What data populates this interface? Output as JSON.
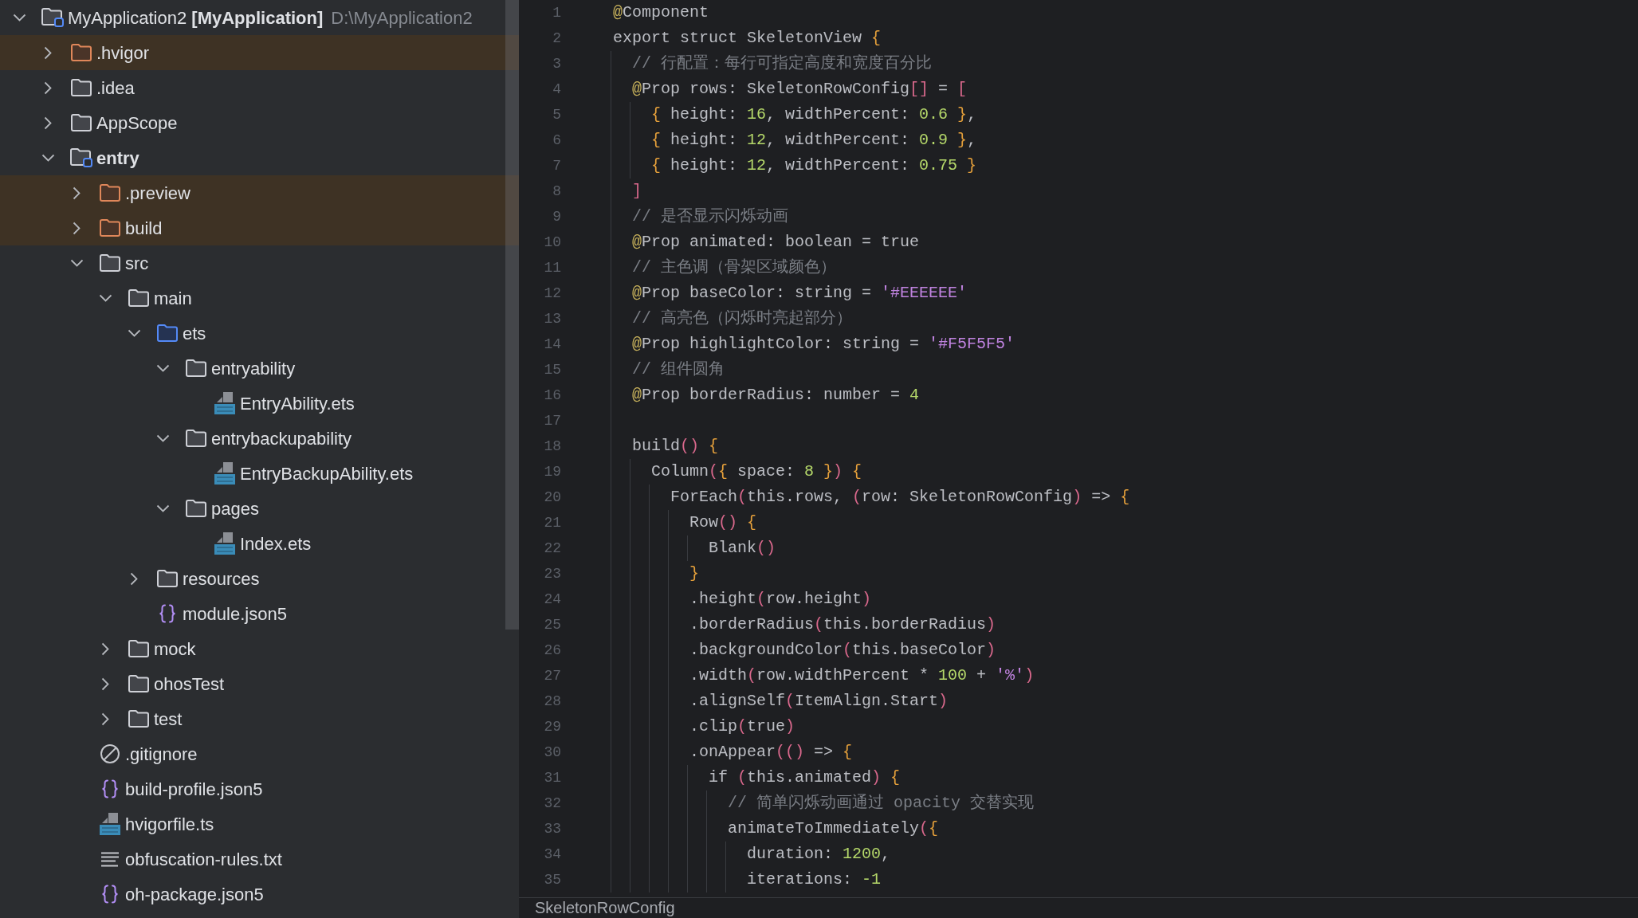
{
  "project_tree": {
    "items": [
      {
        "kind": "project",
        "name": "MyApplication2 **[MyApplication]**",
        "path": "D:\\MyApplication2",
        "expanded": true,
        "excluded": false,
        "children": [
          {
            "kind": "folder",
            "name": ".hvigor",
            "expanded": false,
            "excluded": true
          },
          {
            "kind": "folder",
            "name": ".idea",
            "expanded": false,
            "excluded": false
          },
          {
            "kind": "folder",
            "name": "AppScope",
            "expanded": false,
            "excluded": false
          },
          {
            "kind": "module",
            "name": "entry",
            "expanded": true,
            "excluded": false,
            "children": [
              {
                "kind": "folder",
                "name": ".preview",
                "expanded": false,
                "excluded": true
              },
              {
                "kind": "folder",
                "name": "build",
                "expanded": false,
                "excluded": true
              },
              {
                "kind": "folder",
                "name": "src",
                "expanded": true,
                "excluded": false,
                "children": [
                  {
                    "kind": "folder",
                    "name": "main",
                    "expanded": true,
                    "excluded": false,
                    "children": [
                      {
                        "kind": "source_folder",
                        "name": "ets",
                        "expanded": true,
                        "excluded": false,
                        "children": [
                          {
                            "kind": "folder",
                            "name": "entryability",
                            "expanded": true,
                            "excluded": false,
                            "children": [
                              {
                                "kind": "ets",
                                "name": "EntryAbility.ets",
                                "excluded": false
                              }
                            ]
                          },
                          {
                            "kind": "folder",
                            "name": "entrybackupability",
                            "expanded": true,
                            "excluded": false,
                            "children": [
                              {
                                "kind": "ets",
                                "name": "EntryBackupAbility.ets",
                                "excluded": false
                              }
                            ]
                          },
                          {
                            "kind": "folder",
                            "name": "pages",
                            "expanded": true,
                            "excluded": false,
                            "children": [
                              {
                                "kind": "ets",
                                "name": "Index.ets",
                                "excluded": false
                              }
                            ]
                          }
                        ]
                      },
                      {
                        "kind": "folder",
                        "name": "resources",
                        "expanded": false,
                        "excluded": false
                      },
                      {
                        "kind": "json5",
                        "name": "module.json5",
                        "excluded": false
                      }
                    ]
                  },
                  {
                    "kind": "folder",
                    "name": "mock",
                    "expanded": false,
                    "excluded": false
                  },
                  {
                    "kind": "folder",
                    "name": "ohosTest",
                    "expanded": false,
                    "excluded": false
                  },
                  {
                    "kind": "folder",
                    "name": "test",
                    "expanded": false,
                    "excluded": false
                  }
                ]
              },
              {
                "kind": "gitignore",
                "name": ".gitignore",
                "excluded": false
              },
              {
                "kind": "json5",
                "name": "build-profile.json5",
                "excluded": false
              },
              {
                "kind": "ts",
                "name": "hvigorfile.ts",
                "excluded": false
              },
              {
                "kind": "text",
                "name": "obfuscation-rules.txt",
                "excluded": false
              },
              {
                "kind": "json5",
                "name": "oh-package.json5",
                "excluded": false
              }
            ]
          }
        ]
      }
    ]
  },
  "editor": {
    "lines": [
      {
        "number": "1",
        "tokens": [
          {
            "kind": "annotation",
            "text": "@"
          },
          {
            "kind": "plain",
            "text": "Component"
          }
        ]
      },
      {
        "number": "2",
        "tokens": [
          {
            "kind": "plain",
            "text": "export struct SkeletonView "
          },
          {
            "kind": "brace",
            "text": "{"
          }
        ],
        "children": [
          {
            "number": "3",
            "tokens": [
              {
                "kind": "comment",
                "text": "// 行配置：每行可指定高度和宽度百分比"
              }
            ]
          },
          {
            "number": "4",
            "tokens": [
              {
                "kind": "annotation",
                "text": "@"
              },
              {
                "kind": "plain",
                "text": "Prop rows: SkeletonRowConfig"
              },
              {
                "kind": "paren",
                "text": "[]"
              },
              {
                "kind": "plain",
                "text": " = "
              },
              {
                "kind": "paren",
                "text": "["
              }
            ],
            "children": [
              {
                "number": "5",
                "tokens": [
                  {
                    "kind": "brace",
                    "text": "{"
                  },
                  {
                    "kind": "plain",
                    "text": " height: "
                  },
                  {
                    "kind": "number",
                    "text": "16"
                  },
                  {
                    "kind": "plain",
                    "text": ", widthPercent: "
                  },
                  {
                    "kind": "number",
                    "text": "0.6"
                  },
                  {
                    "kind": "brace",
                    "text": " }"
                  },
                  {
                    "kind": "plain",
                    "text": ","
                  }
                ]
              },
              {
                "number": "6",
                "tokens": [
                  {
                    "kind": "brace",
                    "text": "{"
                  },
                  {
                    "kind": "plain",
                    "text": " height: "
                  },
                  {
                    "kind": "number",
                    "text": "12"
                  },
                  {
                    "kind": "plain",
                    "text": ", widthPercent: "
                  },
                  {
                    "kind": "number",
                    "text": "0.9"
                  },
                  {
                    "kind": "brace",
                    "text": " }"
                  },
                  {
                    "kind": "plain",
                    "text": ","
                  }
                ]
              },
              {
                "number": "7",
                "tokens": [
                  {
                    "kind": "brace",
                    "text": "{"
                  },
                  {
                    "kind": "plain",
                    "text": " height: "
                  },
                  {
                    "kind": "number",
                    "text": "12"
                  },
                  {
                    "kind": "plain",
                    "text": ", widthPercent: "
                  },
                  {
                    "kind": "number",
                    "text": "0.75"
                  },
                  {
                    "kind": "brace",
                    "text": " }"
                  }
                ]
              }
            ]
          },
          {
            "number": "8",
            "tokens": [
              {
                "kind": "paren",
                "text": "]"
              }
            ]
          },
          {
            "number": "9",
            "tokens": [
              {
                "kind": "comment",
                "text": "// 是否显示闪烁动画"
              }
            ]
          },
          {
            "number": "10",
            "tokens": [
              {
                "kind": "annotation",
                "text": "@"
              },
              {
                "kind": "plain",
                "text": "Prop animated: boolean = true"
              }
            ]
          },
          {
            "number": "11",
            "tokens": [
              {
                "kind": "comment",
                "text": "// 主色调（骨架区域颜色）"
              }
            ]
          },
          {
            "number": "12",
            "tokens": [
              {
                "kind": "annotation",
                "text": "@"
              },
              {
                "kind": "plain",
                "text": "Prop baseColor: string = "
              },
              {
                "kind": "string",
                "text": "'#EEEEEE'"
              }
            ]
          },
          {
            "number": "13",
            "tokens": [
              {
                "kind": "comment",
                "text": "// 高亮色（闪烁时亮起部分）"
              }
            ]
          },
          {
            "number": "14",
            "tokens": [
              {
                "kind": "annotation",
                "text": "@"
              },
              {
                "kind": "plain",
                "text": "Prop highlightColor: string = "
              },
              {
                "kind": "string",
                "text": "'#F5F5F5'"
              }
            ]
          },
          {
            "number": "15",
            "tokens": [
              {
                "kind": "comment",
                "text": "// 组件圆角"
              }
            ]
          },
          {
            "number": "16",
            "tokens": [
              {
                "kind": "annotation",
                "text": "@"
              },
              {
                "kind": "plain",
                "text": "Prop borderRadius: number = "
              },
              {
                "kind": "number",
                "text": "4"
              }
            ]
          },
          {
            "number": "17"
          },
          {
            "number": "18",
            "tokens": [
              {
                "kind": "plain",
                "text": "build"
              },
              {
                "kind": "paren",
                "text": "()"
              },
              {
                "kind": "brace",
                "text": " {"
              }
            ],
            "children": [
              {
                "number": "19",
                "tokens": [
                  {
                    "kind": "plain",
                    "text": "Column"
                  },
                  {
                    "kind": "paren",
                    "text": "("
                  },
                  {
                    "kind": "brace",
                    "text": "{"
                  },
                  {
                    "kind": "plain",
                    "text": " space: "
                  },
                  {
                    "kind": "number",
                    "text": "8"
                  },
                  {
                    "kind": "brace",
                    "text": " }"
                  },
                  {
                    "kind": "paren",
                    "text": ")"
                  },
                  {
                    "kind": "brace",
                    "text": " {"
                  }
                ],
                "children": [
                  {
                    "number": "20",
                    "tokens": [
                      {
                        "kind": "plain",
                        "text": "ForEach"
                      },
                      {
                        "kind": "paren",
                        "text": "("
                      },
                      {
                        "kind": "plain",
                        "text": "this.rows, "
                      },
                      {
                        "kind": "paren",
                        "text": "("
                      },
                      {
                        "kind": "plain",
                        "text": "row: SkeletonRowConfig"
                      },
                      {
                        "kind": "paren",
                        "text": ")"
                      },
                      {
                        "kind": "plain",
                        "text": " => "
                      },
                      {
                        "kind": "brace",
                        "text": "{"
                      }
                    ],
                    "children": [
                      {
                        "number": "21",
                        "tokens": [
                          {
                            "kind": "plain",
                            "text": "Row"
                          },
                          {
                            "kind": "paren",
                            "text": "()"
                          },
                          {
                            "kind": "brace",
                            "text": " {"
                          }
                        ],
                        "children": [
                          {
                            "number": "22",
                            "tokens": [
                              {
                                "kind": "plain",
                                "text": "Blank"
                              },
                              {
                                "kind": "paren",
                                "text": "()"
                              }
                            ]
                          }
                        ]
                      },
                      {
                        "number": "23",
                        "tokens": [
                          {
                            "kind": "brace",
                            "text": "}"
                          }
                        ]
                      },
                      {
                        "number": "24",
                        "tokens": [
                          {
                            "kind": "plain",
                            "text": ".height"
                          },
                          {
                            "kind": "paren",
                            "text": "("
                          },
                          {
                            "kind": "plain",
                            "text": "row.height"
                          },
                          {
                            "kind": "paren",
                            "text": ")"
                          }
                        ]
                      },
                      {
                        "number": "25",
                        "tokens": [
                          {
                            "kind": "plain",
                            "text": ".borderRadius"
                          },
                          {
                            "kind": "paren",
                            "text": "("
                          },
                          {
                            "kind": "plain",
                            "text": "this.borderRadius"
                          },
                          {
                            "kind": "paren",
                            "text": ")"
                          }
                        ]
                      },
                      {
                        "number": "26",
                        "tokens": [
                          {
                            "kind": "plain",
                            "text": ".backgroundColor"
                          },
                          {
                            "kind": "paren",
                            "text": "("
                          },
                          {
                            "kind": "plain",
                            "text": "this.baseColor"
                          },
                          {
                            "kind": "paren",
                            "text": ")"
                          }
                        ]
                      },
                      {
                        "number": "27",
                        "tokens": [
                          {
                            "kind": "plain",
                            "text": ".width"
                          },
                          {
                            "kind": "paren",
                            "text": "("
                          },
                          {
                            "kind": "plain",
                            "text": "row.widthPercent * "
                          },
                          {
                            "kind": "number",
                            "text": "100"
                          },
                          {
                            "kind": "plain",
                            "text": " + "
                          },
                          {
                            "kind": "string",
                            "text": "'%'"
                          },
                          {
                            "kind": "paren",
                            "text": ")"
                          }
                        ]
                      },
                      {
                        "number": "28",
                        "tokens": [
                          {
                            "kind": "plain",
                            "text": ".alignSelf"
                          },
                          {
                            "kind": "paren",
                            "text": "("
                          },
                          {
                            "kind": "plain",
                            "text": "ItemAlign.Start"
                          },
                          {
                            "kind": "paren",
                            "text": ")"
                          }
                        ]
                      },
                      {
                        "number": "29",
                        "tokens": [
                          {
                            "kind": "plain",
                            "text": ".clip"
                          },
                          {
                            "kind": "paren",
                            "text": "("
                          },
                          {
                            "kind": "plain",
                            "text": "true"
                          },
                          {
                            "kind": "paren",
                            "text": ")"
                          }
                        ]
                      },
                      {
                        "number": "30",
                        "tokens": [
                          {
                            "kind": "plain",
                            "text": ".onAppear"
                          },
                          {
                            "kind": "paren",
                            "text": "(()"
                          },
                          {
                            "kind": "plain",
                            "text": " => "
                          },
                          {
                            "kind": "brace",
                            "text": "{"
                          }
                        ],
                        "children": [
                          {
                            "number": "31",
                            "tokens": [
                              {
                                "kind": "plain",
                                "text": "if "
                              },
                              {
                                "kind": "paren",
                                "text": "("
                              },
                              {
                                "kind": "plain",
                                "text": "this.animated"
                              },
                              {
                                "kind": "paren",
                                "text": ")"
                              },
                              {
                                "kind": "brace",
                                "text": " {"
                              }
                            ],
                            "children": [
                              {
                                "number": "32",
                                "tokens": [
                                  {
                                    "kind": "comment",
                                    "text": "// 简单闪烁动画通过 opacity 交替实现"
                                  }
                                ]
                              },
                              {
                                "number": "33",
                                "tokens": [
                                  {
                                    "kind": "plain",
                                    "text": "animateToImmediately"
                                  },
                                  {
                                    "kind": "paren",
                                    "text": "("
                                  },
                                  {
                                    "kind": "brace",
                                    "text": "{"
                                  }
                                ],
                                "children": [
                                  {
                                    "number": "34",
                                    "tokens": [
                                      {
                                        "kind": "plain",
                                        "text": "duration: "
                                      },
                                      {
                                        "kind": "number",
                                        "text": "1200"
                                      },
                                      {
                                        "kind": "plain",
                                        "text": ","
                                      }
                                    ]
                                  },
                                  {
                                    "number": "35",
                                    "tokens": [
                                      {
                                        "kind": "plain",
                                        "text": "iterations: "
                                      },
                                      {
                                        "kind": "number",
                                        "text": "-1"
                                      }
                                    ]
                                  }
                                ]
                              }
                            ]
                          }
                        ]
                      }
                    ]
                  }
                ]
              }
            ]
          }
        ]
      }
    ],
    "breadcrumb": "SkeletonRowConfig"
  }
}
